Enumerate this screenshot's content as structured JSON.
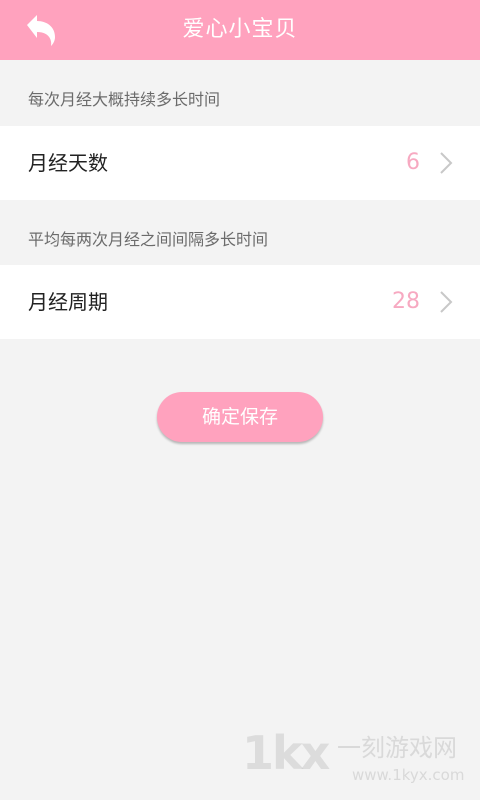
{
  "header": {
    "title": "爱心小宝贝",
    "back_icon": "back-arrow-icon"
  },
  "sections": [
    {
      "label": "每次月经大概持续多长时间",
      "row_label": "月经天数",
      "row_value": "6"
    },
    {
      "label": "平均每两次月经之间间隔多长时间",
      "row_label": "月经周期",
      "row_value": "28"
    }
  ],
  "save_button": {
    "label": "确定保存"
  },
  "watermark": {
    "logo": "1kx",
    "text": "一刻游戏网",
    "url": "www.1kyx.com"
  },
  "colors": {
    "header_bg": "#ffa2be",
    "accent_value": "#f7a9c1",
    "page_bg": "#f3f3f3"
  }
}
